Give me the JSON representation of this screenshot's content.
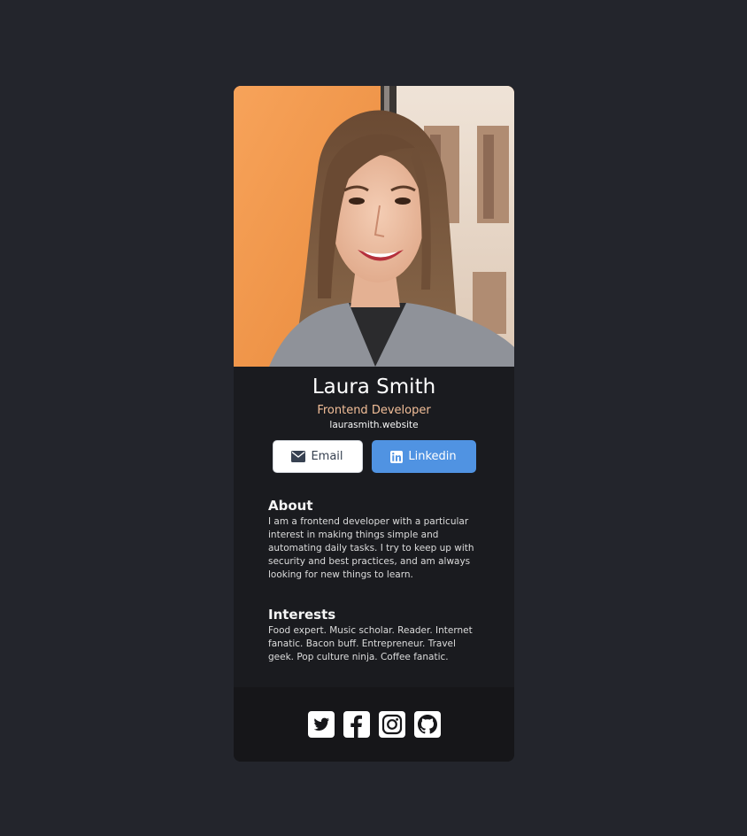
{
  "profile": {
    "name": "Laura Smith",
    "title": "Frontend Developer",
    "website": "laurasmith.website"
  },
  "buttons": {
    "email_label": "Email",
    "email_icon": "envelope-icon",
    "linkedin_label": "Linkedin",
    "linkedin_icon": "linkedin-icon"
  },
  "about": {
    "heading": "About",
    "text": "I am a frontend developer with a particular interest in making things simple and automating daily tasks. I try to keep up with security and best practices, and am always looking for new things to learn."
  },
  "interests": {
    "heading": "Interests",
    "text": "Food expert. Music scholar. Reader. Internet fanatic. Bacon buff. Entrepreneur. Travel geek. Pop culture ninja. Coffee fanatic."
  },
  "footer": {
    "icons": [
      "twitter-icon",
      "facebook-icon",
      "instagram-icon",
      "github-icon"
    ]
  },
  "colors": {
    "background": "#23252c",
    "card": "#1a1b1f",
    "footer": "#161619",
    "title_accent": "#f3bf99",
    "linkedin_button": "#5093e2"
  }
}
